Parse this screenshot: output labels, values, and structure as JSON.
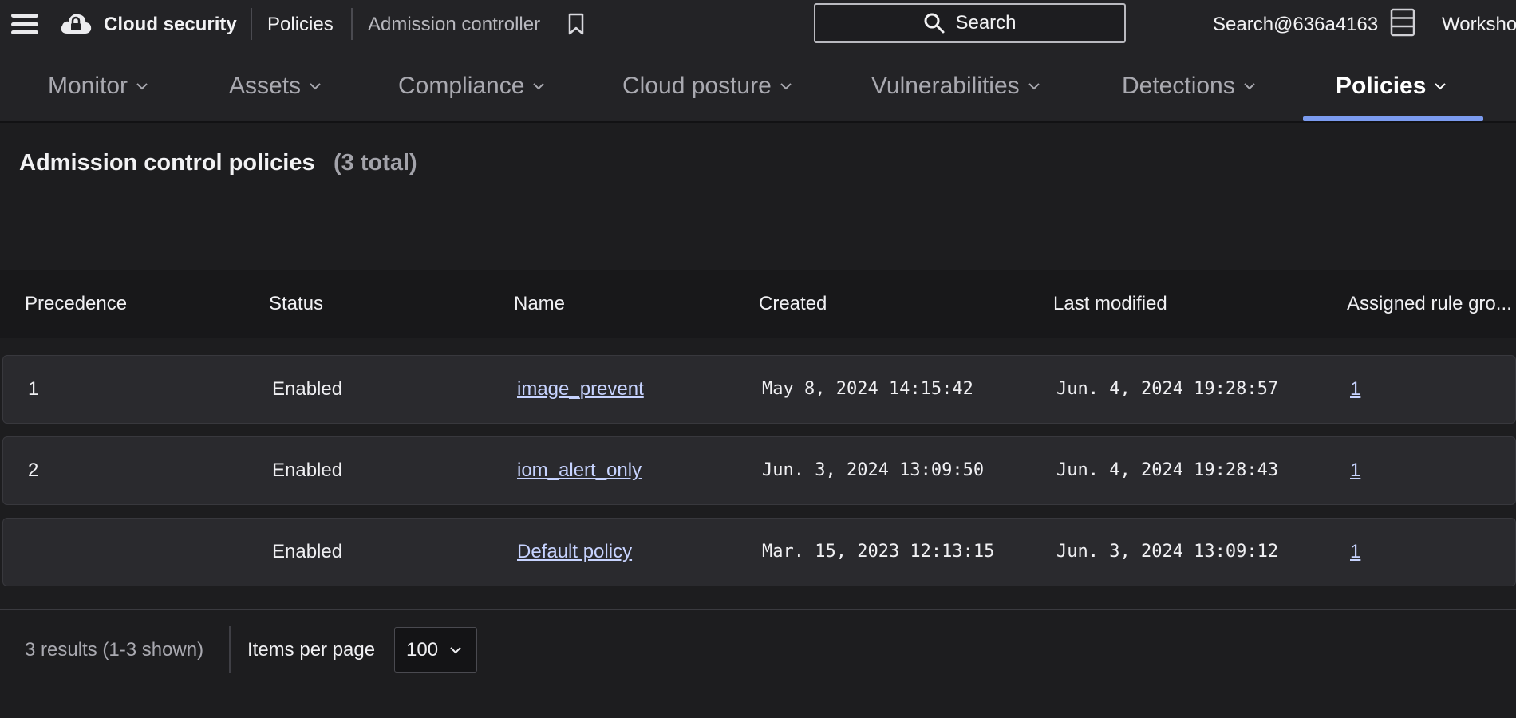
{
  "topbar": {
    "app_title": "Cloud security",
    "breadcrumbs": [
      "Policies",
      "Admission controller"
    ],
    "search_label": "Search",
    "account_name": "Search@636a4163",
    "workspace_label": "Worksho",
    "icons": [
      "menu-icon",
      "cloud-lock-icon",
      "bookmark-icon",
      "search-icon",
      "server-icon"
    ]
  },
  "nav": {
    "items": [
      {
        "label": "Monitor",
        "active": false
      },
      {
        "label": "Assets",
        "active": false
      },
      {
        "label": "Compliance",
        "active": false
      },
      {
        "label": "Cloud posture",
        "active": false
      },
      {
        "label": "Vulnerabilities",
        "active": false
      },
      {
        "label": "Detections",
        "active": false
      },
      {
        "label": "Policies",
        "active": true
      }
    ],
    "accent_color": "#7b9bef"
  },
  "page": {
    "title": "Admission control policies",
    "count": "(3 total)"
  },
  "table": {
    "columns": [
      "Precedence",
      "Status",
      "Name",
      "Created",
      "Last modified",
      "Assigned rule gro..."
    ],
    "rows": [
      {
        "precedence": "1",
        "status": "Enabled",
        "name": "image_prevent",
        "created": "May 8, 2024 14:15:42",
        "last_modified": "Jun. 4, 2024 19:28:57",
        "assigned": "1"
      },
      {
        "precedence": "2",
        "status": "Enabled",
        "name": "iom_alert_only",
        "created": "Jun. 3, 2024 13:09:50",
        "last_modified": "Jun. 4, 2024 19:28:43",
        "assigned": "1"
      },
      {
        "precedence": "",
        "status": "Enabled",
        "name": "Default policy",
        "created": "Mar. 15, 2023 12:13:15",
        "last_modified": "Jun. 3, 2024 13:09:12",
        "assigned": "1"
      }
    ]
  },
  "footer": {
    "results_text": "3 results (1-3 shown)",
    "items_per_page_label": "Items per page",
    "items_per_page_value": "100"
  }
}
